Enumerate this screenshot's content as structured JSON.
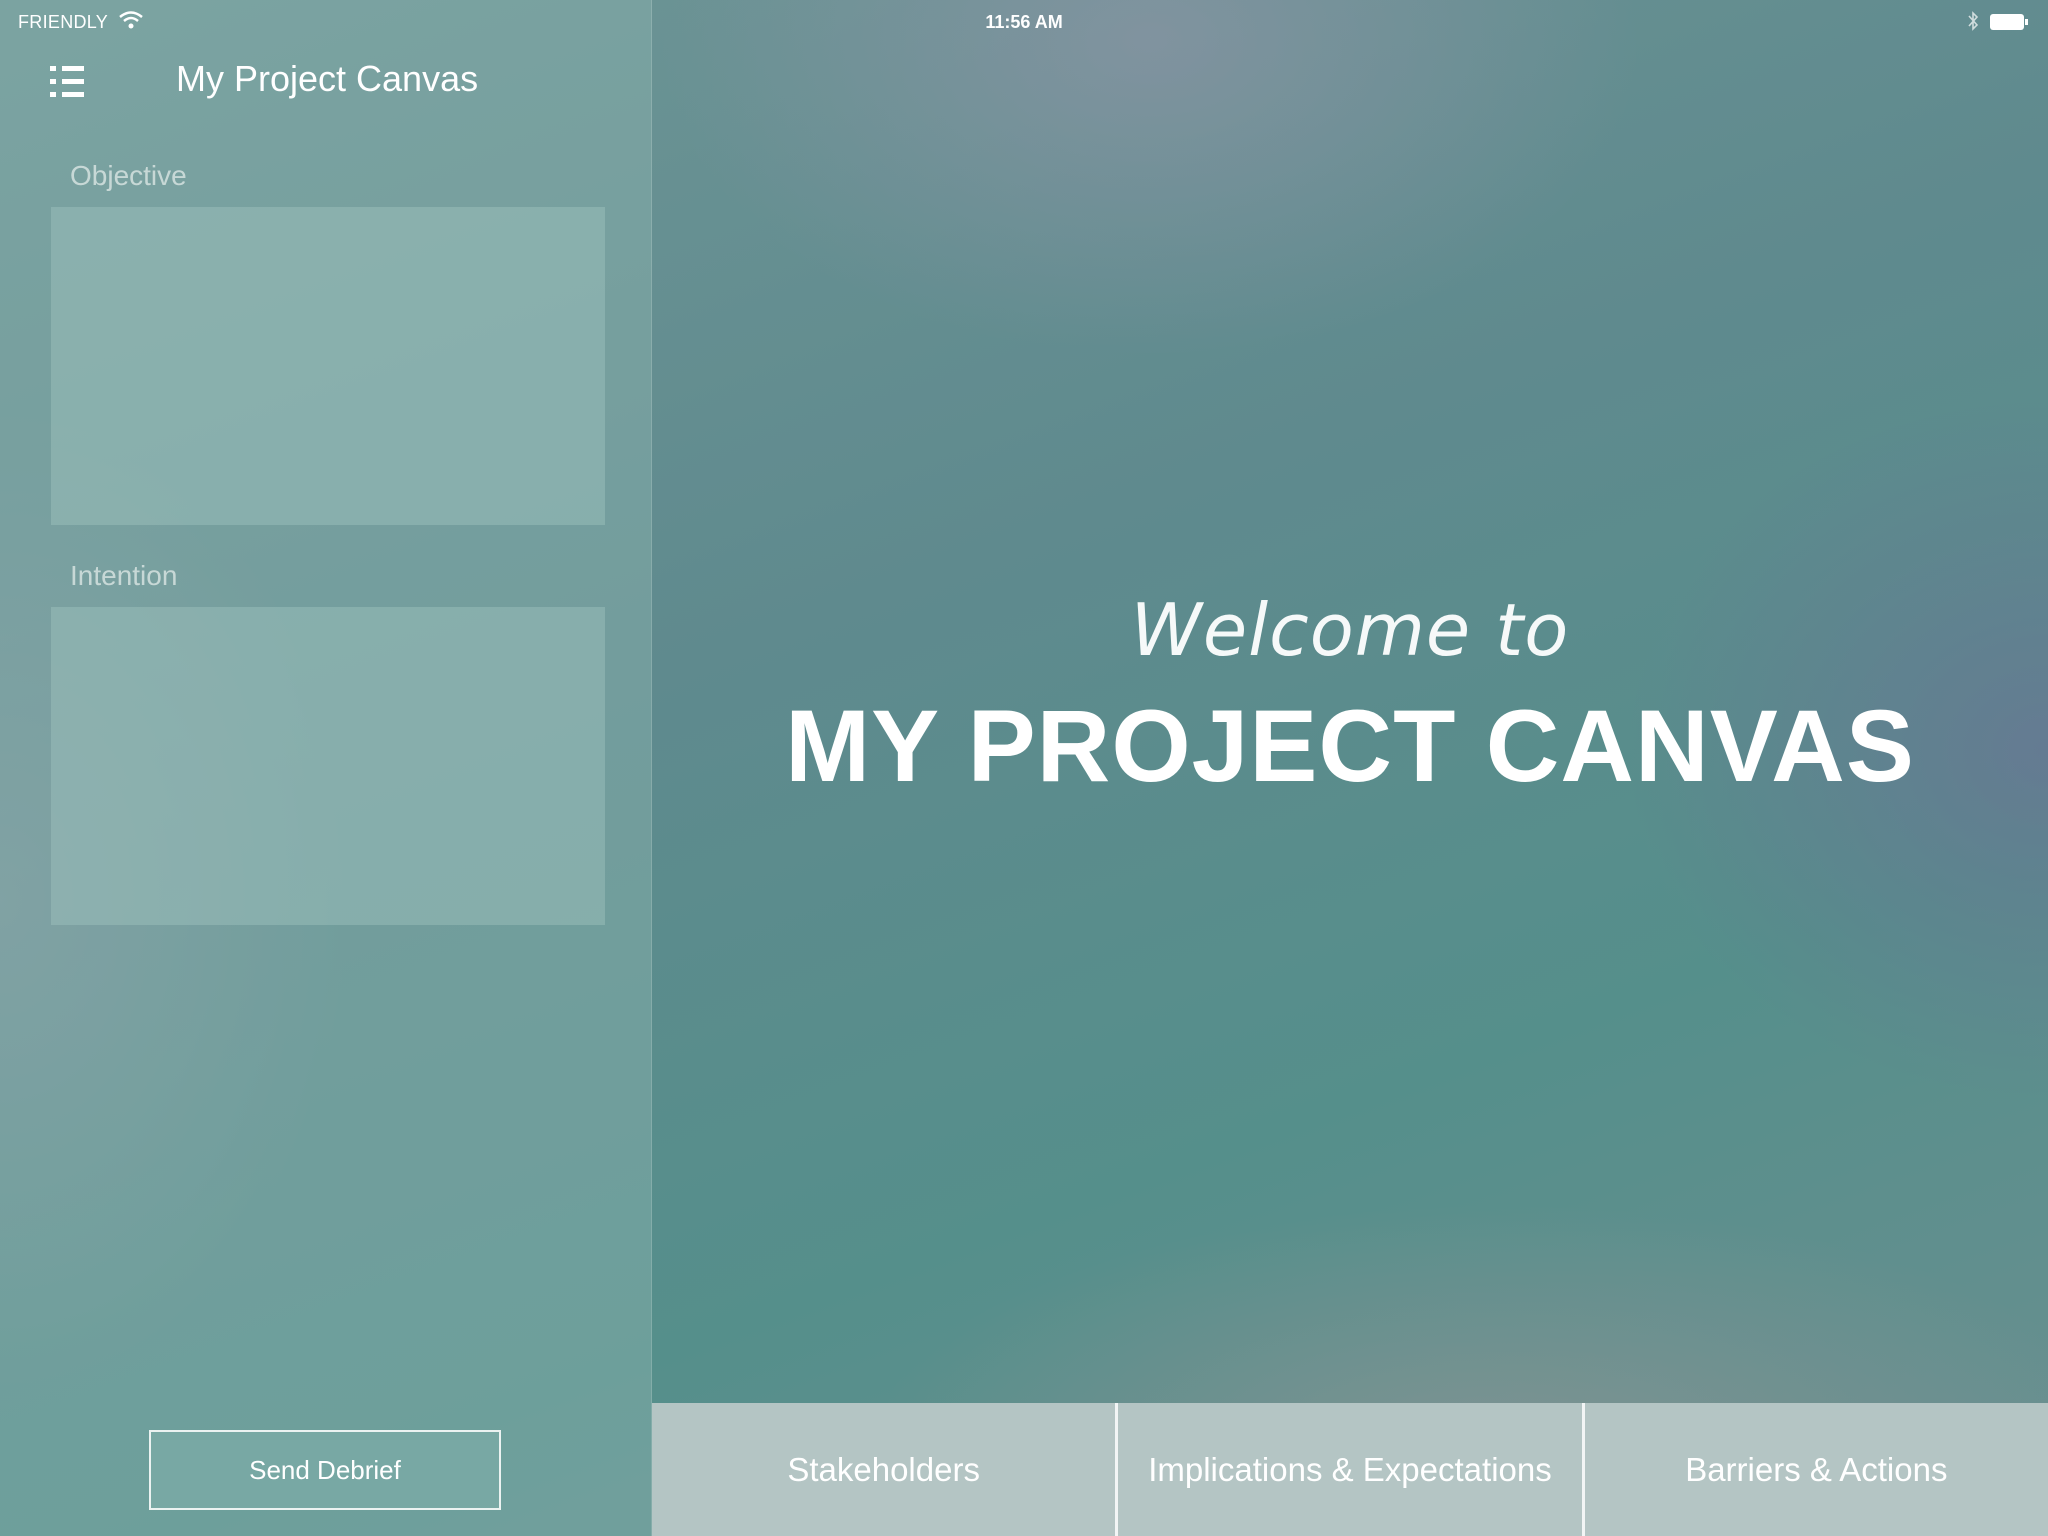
{
  "status_bar": {
    "carrier": "FRIENDLY",
    "time": "11:56 AM",
    "wifi_icon": "wifi-icon",
    "bluetooth_icon": "bluetooth-icon",
    "battery_icon": "battery-icon"
  },
  "sidebar": {
    "menu_icon": "list-menu-icon",
    "title": "My Project Canvas",
    "fields": [
      {
        "label": "Objective",
        "value": ""
      },
      {
        "label": "Intention",
        "value": ""
      }
    ],
    "send_button": "Send Debrief"
  },
  "main": {
    "welcome": "Welcome to",
    "headline": "MY PROJECT CANVAS"
  },
  "tabs": [
    {
      "label": "Stakeholders"
    },
    {
      "label": "Implications & Expectations"
    },
    {
      "label": "Barriers & Actions"
    }
  ],
  "colors": {
    "background": "#5a8e8e",
    "tab_background": "#b4c5c4",
    "text": "#ffffff"
  }
}
